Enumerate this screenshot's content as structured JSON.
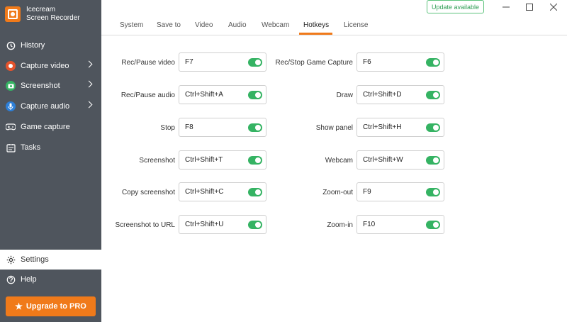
{
  "app": {
    "name_line1": "Icecream",
    "name_line2": "Screen Recorder"
  },
  "sidebar": {
    "items": [
      {
        "label": "History",
        "icon": "clock-icon"
      },
      {
        "label": "Capture video",
        "icon": "record-icon",
        "has_submenu": true
      },
      {
        "label": "Screenshot",
        "icon": "camera-icon",
        "has_submenu": true
      },
      {
        "label": "Capture audio",
        "icon": "microphone-icon",
        "has_submenu": true
      },
      {
        "label": "Game capture",
        "icon": "gamepad-icon"
      },
      {
        "label": "Tasks",
        "icon": "tasks-icon"
      }
    ],
    "settings": {
      "label": "Settings",
      "icon": "gear-icon"
    },
    "help": {
      "label": "Help",
      "icon": "help-icon"
    },
    "upgrade_label": "Upgrade to PRO"
  },
  "header": {
    "update_label": "Update available"
  },
  "tabs": [
    {
      "label": "System"
    },
    {
      "label": "Save to"
    },
    {
      "label": "Video"
    },
    {
      "label": "Audio"
    },
    {
      "label": "Webcam"
    },
    {
      "label": "Hotkeys",
      "active": true
    },
    {
      "label": "License"
    }
  ],
  "hotkeys": {
    "left": [
      {
        "label": "Rec/Pause video",
        "value": "F7",
        "enabled": true
      },
      {
        "label": "Rec/Pause audio",
        "value": "Ctrl+Shift+A",
        "enabled": true
      },
      {
        "label": "Stop",
        "value": "F8",
        "enabled": true
      },
      {
        "label": "Screenshot",
        "value": "Ctrl+Shift+T",
        "enabled": true
      },
      {
        "label": "Copy screenshot",
        "value": "Ctrl+Shift+C",
        "enabled": true
      },
      {
        "label": "Screenshot to URL",
        "value": "Ctrl+Shift+U",
        "enabled": true
      }
    ],
    "right": [
      {
        "label": "Rec/Stop Game Capture",
        "value": "F6",
        "enabled": true
      },
      {
        "label": "Draw",
        "value": "Ctrl+Shift+D",
        "enabled": true
      },
      {
        "label": "Show panel",
        "value": "Ctrl+Shift+H",
        "enabled": true
      },
      {
        "label": "Webcam",
        "value": "Ctrl+Shift+W",
        "enabled": true
      },
      {
        "label": "Zoom-out",
        "value": "F9",
        "enabled": true
      },
      {
        "label": "Zoom-in",
        "value": "F10",
        "enabled": true
      }
    ]
  },
  "colors": {
    "sidebar_bg": "#4f555d",
    "accent": "#f07a1a",
    "toggle_on": "#35b363"
  }
}
